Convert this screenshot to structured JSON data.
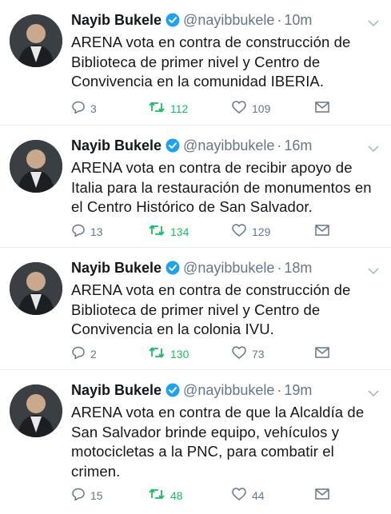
{
  "colors": {
    "text": "#14171a",
    "muted": "#657786",
    "retweet": "#17bf63",
    "verified": "#1da1f2",
    "divider": "#e6ecf0"
  },
  "icons": [
    "verified-icon",
    "chevron-down-icon",
    "reply-icon",
    "retweet-icon",
    "like-icon",
    "message-icon"
  ],
  "tweets": [
    {
      "name": "Nayib Bukele",
      "handle": "@nayibbukele",
      "dot": "·",
      "time": "10m",
      "text": "ARENA vota en contra de construcción de Biblioteca de primer nivel y Centro de Convivencia en la comunidad IBERIA.",
      "replies": "3",
      "retweets": "112",
      "likes": "109"
    },
    {
      "name": "Nayib Bukele",
      "handle": "@nayibbukele",
      "dot": "·",
      "time": "16m",
      "text": "ARENA vota en contra de recibir apoyo de Italia para la restauración de monumentos en el Centro Histórico de San Salvador.",
      "replies": "13",
      "retweets": "134",
      "likes": "129"
    },
    {
      "name": "Nayib Bukele",
      "handle": "@nayibbukele",
      "dot": "·",
      "time": "18m",
      "text": "ARENA vota en contra de construcción de Biblioteca de primer nivel y Centro de Convivencia en la colonia IVU.",
      "replies": "2",
      "retweets": "130",
      "likes": "73"
    },
    {
      "name": "Nayib Bukele",
      "handle": "@nayibbukele",
      "dot": "·",
      "time": "19m",
      "text": "ARENA vota en contra de que la Alcaldía de San Salvador brinde equipo, vehículos y motocicletas a la PNC, para combatir el crimen.",
      "replies": "15",
      "retweets": "48",
      "likes": "44"
    }
  ]
}
